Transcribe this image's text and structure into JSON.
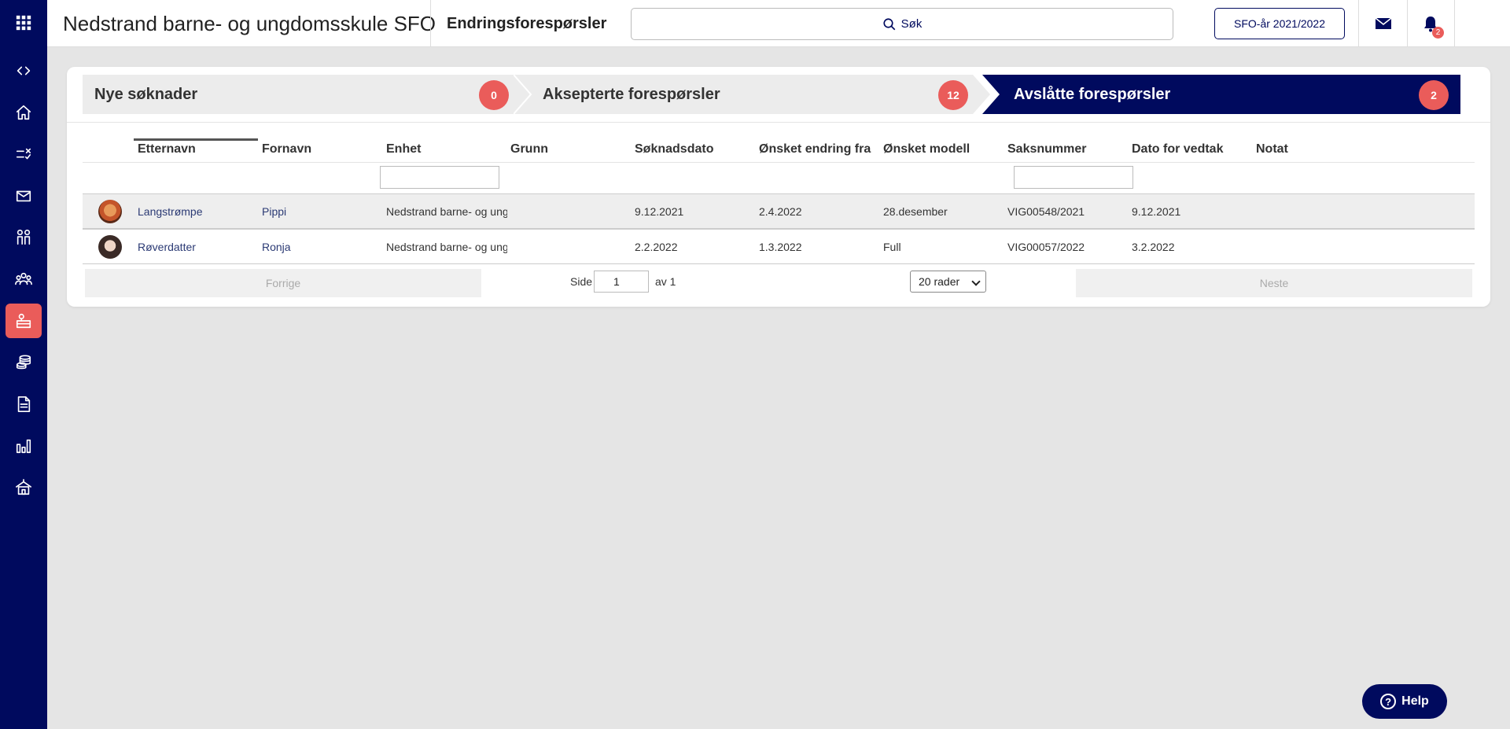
{
  "header": {
    "app_title": "Nedstrand barne- og ungdomsskule SFO",
    "page_title": "Endringsforespørsler",
    "search_label": "Søk",
    "year_button": "SFO-år 2021/2022",
    "notification_count": "2"
  },
  "sidebar": {
    "items": [
      {
        "icon": "apps-grid-icon"
      },
      {
        "icon": "expand-collapse-icon"
      },
      {
        "icon": "home-icon"
      },
      {
        "icon": "tasks-icon"
      },
      {
        "icon": "mail-icon"
      },
      {
        "icon": "children-icon"
      },
      {
        "icon": "groups-icon"
      },
      {
        "icon": "sfo-icon",
        "active": true
      },
      {
        "icon": "payments-icon"
      },
      {
        "icon": "document-icon"
      },
      {
        "icon": "statistics-icon"
      },
      {
        "icon": "school-icon"
      }
    ]
  },
  "steps": [
    {
      "label": "Nye søknader",
      "count": "0"
    },
    {
      "label": "Aksepterte forespørsler",
      "count": "12"
    },
    {
      "label": "Avslåtte forespørsler",
      "count": "2",
      "active": true
    }
  ],
  "table": {
    "columns": [
      "Etternavn",
      "Fornavn",
      "Enhet",
      "Grunn",
      "Søknadsdato",
      "Ønsket endring fra",
      "Ønsket modell",
      "Saksnummer",
      "Dato for vedtak",
      "Notat"
    ],
    "rows": [
      {
        "etternavn": "Langstrømpe",
        "fornavn": "Pippi",
        "enhet": "Nedstrand barne- og ungdomsskule SFO",
        "grunn": "",
        "soknadsdato": "9.12.2021",
        "endring_fra": "2.4.2022",
        "modell": "28.desember",
        "saksnummer": "VIG00548/2021",
        "vedtak": "9.12.2021",
        "notat": ""
      },
      {
        "etternavn": "Røverdatter",
        "fornavn": "Ronja",
        "enhet": "Nedstrand barne- og ungdomsskule SFO",
        "grunn": "",
        "soknadsdato": "2.2.2022",
        "endring_fra": "1.3.2022",
        "modell": "Full",
        "saksnummer": "VIG00057/2022",
        "vedtak": "3.2.2022",
        "notat": ""
      }
    ]
  },
  "pager": {
    "prev": "Forrige",
    "next": "Neste",
    "page_label": "Side",
    "page_value": "1",
    "of_label": "av 1",
    "rows_select": "20 rader"
  },
  "help_label": "Help",
  "colors": {
    "navy": "#000a5e",
    "accent": "#ea5c5a"
  }
}
